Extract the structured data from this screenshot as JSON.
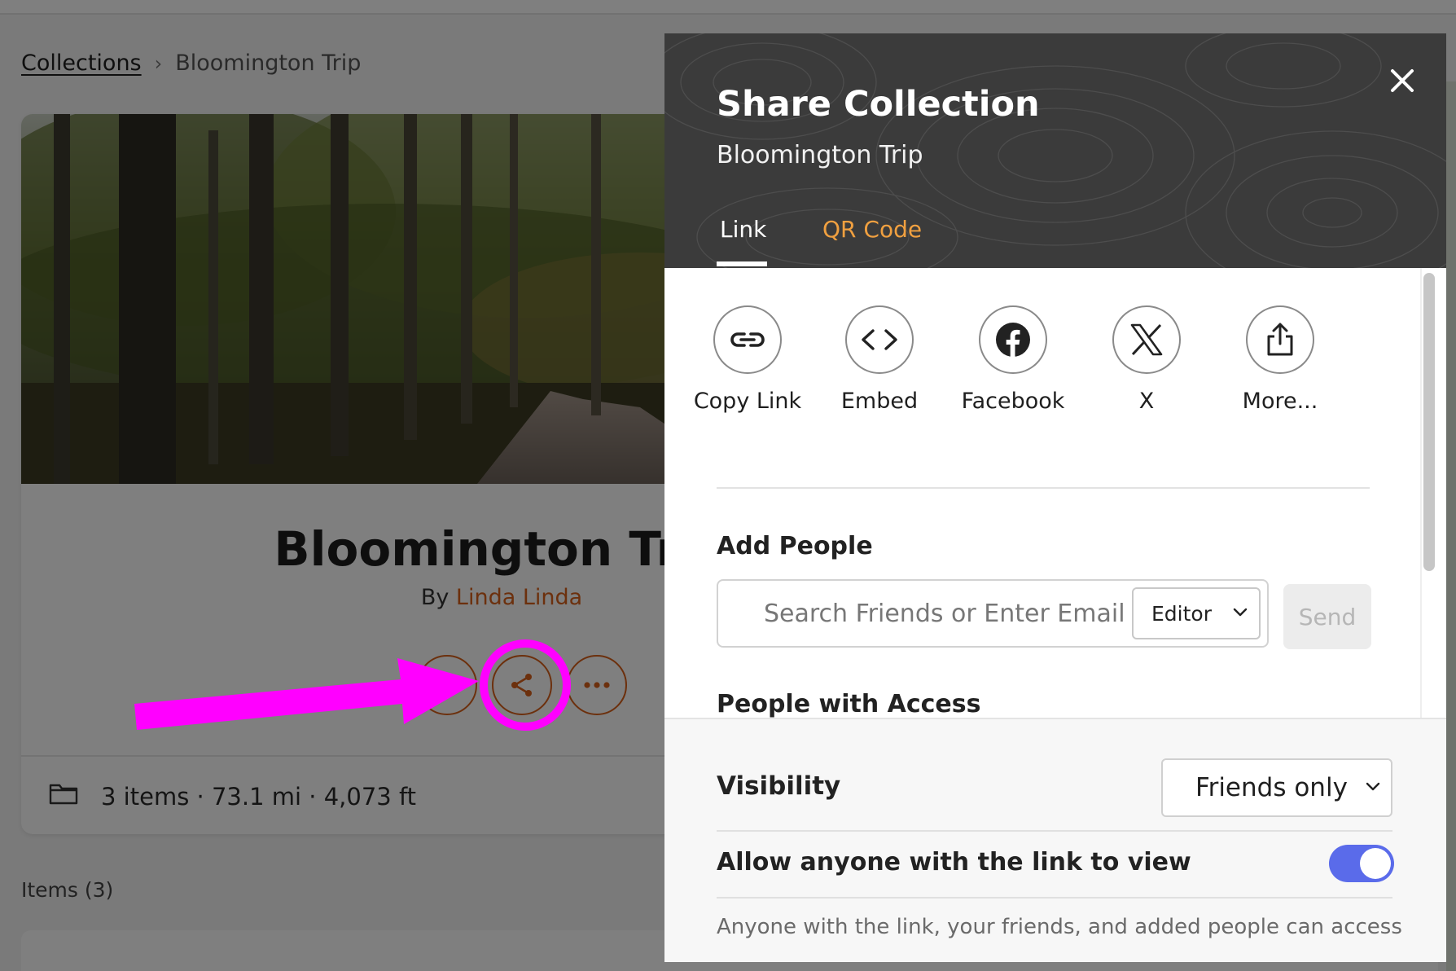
{
  "breadcrumb": {
    "root": "Collections",
    "separator": "›",
    "current": "Bloomington Trip"
  },
  "collection": {
    "title": "Bloomington Trip",
    "by_prefix": "By",
    "author": "Linda Linda",
    "stats": "3 items · 73.1 mi · 4,073 ft",
    "items_label": "Items (3)"
  },
  "modal": {
    "title": "Share Collection",
    "subtitle": "Bloomington Trip",
    "tabs": [
      {
        "label": "Link",
        "active": true
      },
      {
        "label": "QR Code",
        "active": false
      }
    ],
    "share_options": [
      {
        "label": "Copy Link",
        "icon": "link-icon"
      },
      {
        "label": "Embed",
        "icon": "code-icon"
      },
      {
        "label": "Facebook",
        "icon": "facebook-icon"
      },
      {
        "label": "X",
        "icon": "x-logo-icon"
      },
      {
        "label": "More...",
        "icon": "share-upload-icon"
      }
    ],
    "add_people": {
      "title": "Add People",
      "placeholder": "Search Friends or Enter Email",
      "role": "Editor",
      "send_label": "Send"
    },
    "people_with_access_title": "People with Access",
    "visibility": {
      "label": "Visibility",
      "value": "Friends only"
    },
    "allow_link": {
      "label": "Allow anyone with the link to view",
      "enabled": true,
      "note": "Anyone with the link, your friends, and added people can access"
    }
  },
  "colors": {
    "accent": "#d9601a",
    "tab_inactive": "#f0a040",
    "toggle_on": "#5a6bea",
    "highlight": "#ff00ff",
    "header_bg": "#3b3b3b"
  }
}
